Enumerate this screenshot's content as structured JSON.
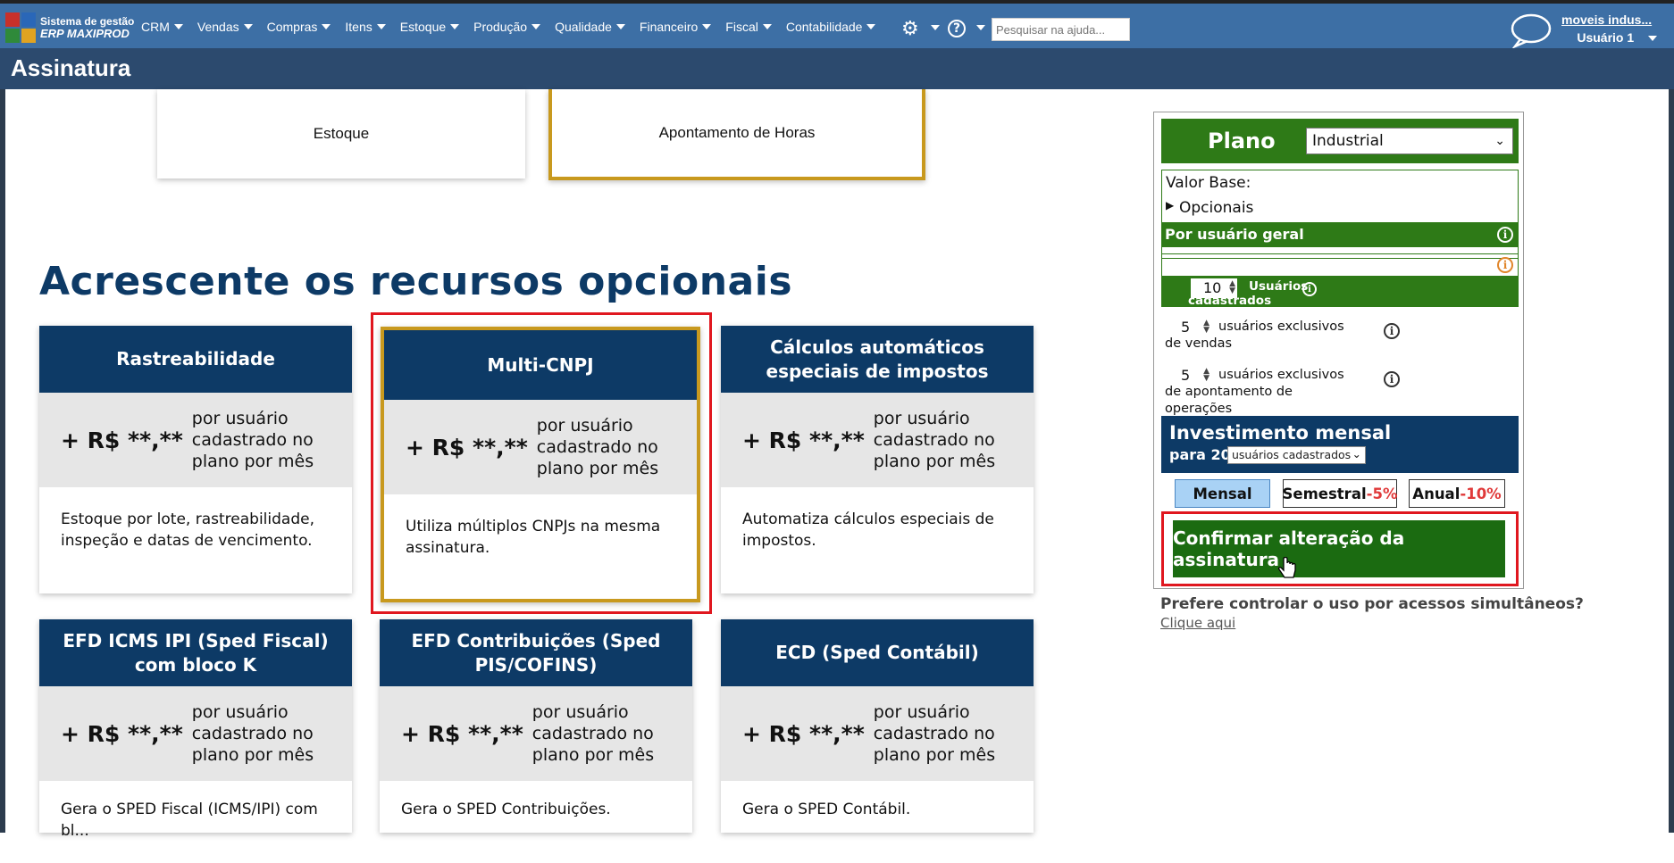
{
  "topbar": {
    "logo_line1": "Sistema de gestão",
    "logo_line2": "ERP MAXIPROD",
    "menu": [
      "CRM",
      "Vendas",
      "Compras",
      "Itens",
      "Estoque",
      "Produção",
      "Qualidade",
      "Financeiro",
      "Fiscal",
      "Contabilidade"
    ],
    "search_placeholder": "Pesquisar na ajuda...",
    "company": "moveis indus...",
    "user": "Usuário 1"
  },
  "page": {
    "title": "Assinatura"
  },
  "top_cards": [
    "Estoque",
    "Apontamento de Horas"
  ],
  "section_heading": "Acrescente os recursos opcionais",
  "cards": [
    {
      "title": "Rastreabilidade",
      "price": "+ R$ **,**",
      "unit": "por usuário cadastrado no plano por mês",
      "desc": "Estoque por lote, rastreabilidade, inspeção e datas de vencimento."
    },
    {
      "title": "Multi-CNPJ",
      "price": "+ R$ **,**",
      "unit": "por usuário cadastrado no plano por mês",
      "desc": "Utiliza múltiplos CNPJs na mesma assinatura."
    },
    {
      "title": "Cálculos automáticos especiais de impostos",
      "price": "+ R$ **,**",
      "unit": "por usuário cadastrado no plano por mês",
      "desc": "Automatiza cálculos especiais de impostos."
    },
    {
      "title": "EFD ICMS IPI (Sped Fiscal) com bloco K",
      "price": "+ R$ **,**",
      "unit": "por usuário cadastrado no plano por mês",
      "desc": "Gera o SPED Fiscal (ICMS/IPI) com bl..."
    },
    {
      "title": "EFD Contribuições (Sped PIS/COFINS)",
      "price": "+ R$ **,**",
      "unit": "por usuário cadastrado no plano por mês",
      "desc": "Gera o SPED Contribuições."
    },
    {
      "title": "ECD (Sped Contábil)",
      "price": "+ R$ **,**",
      "unit": "por usuário cadastrado no plano por mês",
      "desc": "Gera o SPED Contábil."
    }
  ],
  "panel": {
    "plan_label": "Plano",
    "plan_selected": "Industrial",
    "base_value_label": "Valor Base:",
    "optionals_label": "Opcionais",
    "general_user_label": "Por usuário geral",
    "general_users_count": "10",
    "general_users_label": "Usuários cadastrados gerais",
    "sales_users_count": "5",
    "sales_users_label": "usuários exclusivos de vendas",
    "ops_users_count": "5",
    "ops_users_label": "usuários exclusivos de apontamento de operações",
    "investment_title": "Investimento mensal",
    "investment_for": "para 20",
    "investment_select": "usuários cadastrados",
    "period_monthly": "Mensal",
    "period_semester": "Semestral",
    "period_semester_discount": "-5%",
    "period_annual": "Anual",
    "period_annual_discount": "-10%",
    "confirm_label": "Confirmar alteração da assinatura",
    "simultaneous_question": "Prefere controlar o uso por acessos simultâneos?",
    "simultaneous_link": "Clique aqui"
  },
  "colors": {
    "nav_bg": "#3d6fa5",
    "title_bg": "#2c4a6e",
    "card_header": "#0d3a66",
    "plan_green": "#2e7a17",
    "confirm_green": "#1b6b11",
    "highlight_red": "#e0171f",
    "selected_gold": "#c8991e"
  }
}
